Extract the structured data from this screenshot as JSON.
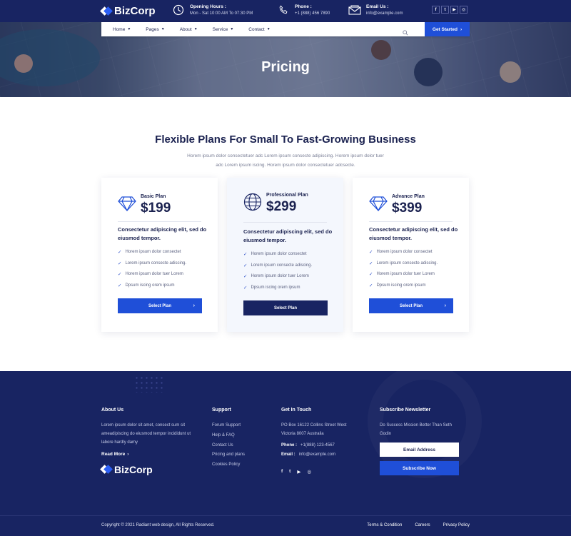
{
  "brand": {
    "name": "BizCorp",
    "accent": "#1f4fd8",
    "navy": "#182462"
  },
  "topbar": {
    "hours_label": "Opening Hours :",
    "hours_value": "Mon - Sat 10:00 AM To 07:30 PM",
    "phone_label": "Phone :",
    "phone_value": "+1 (888) 456 7890",
    "email_label": "Email Us :",
    "email_value": "info@example.com",
    "socials": [
      "f",
      "t",
      "▶",
      "◎"
    ]
  },
  "nav": {
    "items": [
      {
        "label": "Home"
      },
      {
        "label": "Pages"
      },
      {
        "label": "About"
      },
      {
        "label": "Service"
      },
      {
        "label": "Contact"
      }
    ],
    "cta_label": "Get Started"
  },
  "hero": {
    "title": "Pricing"
  },
  "pricing": {
    "title": "Flexible Plans For Small To Fast-Growing Business",
    "subtitle": "Horem ipsum dolor consectetuer adc Lorem ipsum consecte adipiscing. Horem ipsum dolor tuer adc Lorem ipsum iscing. Horem ipsum dolor consectetuer adcsecte.",
    "plans": [
      {
        "name": "Basic Plan",
        "price": "$199",
        "icon": "diamond-icon",
        "desc": "Consectetur adipiscing elit, sed do eiusmod tempor.",
        "features": [
          "Horem ipsum dolor consectet",
          "Lorem ipsum consecte adiscing.",
          "Horem ipsum dolor tuer Lorem",
          "Dpsum iscing orem ipsum"
        ],
        "button": "Select Plan"
      },
      {
        "name": "Professional Plan",
        "price": "$299",
        "icon": "globe-icon",
        "desc": "Consectetur adipiscing elit, sed do eiusmod tempor.",
        "features": [
          "Horem ipsum dolor consectet",
          "Lorem ipsum consecte adiscing.",
          "Horem ipsum dolor tuer Lorem",
          "Dpsum iscing orem ipsum"
        ],
        "button": "Select Plan"
      },
      {
        "name": "Advance Plan",
        "price": "$399",
        "icon": "diamond-icon",
        "desc": "Consectetur adipiscing elit, sed do eiusmod tempor.",
        "features": [
          "Horem ipsum dolor consectet",
          "Lorem ipsum consecte adiscing.",
          "Horem ipsum dolor tuer Lorem",
          "Dpsum iscing orem ipsum"
        ],
        "button": "Select Plan"
      }
    ]
  },
  "footer": {
    "about": {
      "title": "About Us",
      "text": "Lorem ipsum dolor sit amet, consect sum sit ameadipiscing do eiusmod tempor incididunt ut labore hardly damy",
      "read_more": "Read More"
    },
    "support": {
      "title": "Support",
      "links": [
        "Forum Support",
        "Help & FAQ",
        "Contact Us",
        "Pricing and plans",
        "Cookies Policy"
      ]
    },
    "contact": {
      "title": "Get In Touch",
      "address": "PO Box 16122 Collins Street West Victoria 8007 Australia",
      "phone_label": "Phone :",
      "phone_value": "+1(888) 123-4567",
      "email_label": "Email :",
      "email_value": "info@example.com",
      "socials": [
        "f",
        "t",
        "▶",
        "◎"
      ]
    },
    "newsletter": {
      "title": "Subscribe Newsletter",
      "text": "Do Success Mission Better Than Seth Godin",
      "email_placeholder": "Email Address",
      "button": "Subscribe Now"
    },
    "copyright": "Copyright © 2021 Radiant web design, All Rights Reserved.",
    "legal": [
      "Terms & Condition",
      "Careers",
      "Privacy Policy"
    ]
  }
}
